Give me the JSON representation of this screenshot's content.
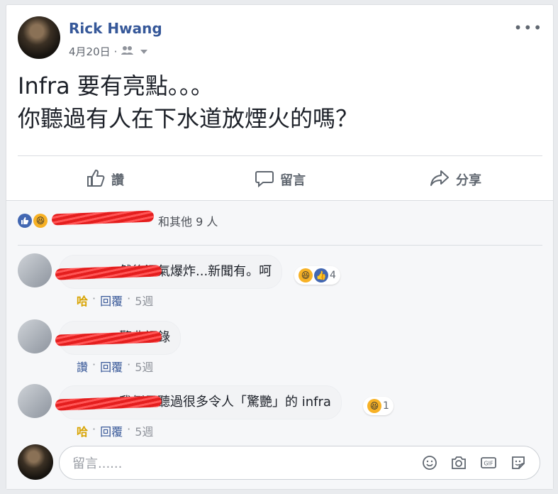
{
  "post": {
    "author": "Rick Hwang",
    "date": "4月20日",
    "more": "•••",
    "lines": [
      "Infra 要有亮點。。。",
      "你聽過有人在下水道放煙火的嗎？"
    ]
  },
  "actions": [
    {
      "label": "讚",
      "icon": "like-icon"
    },
    {
      "label": "留言",
      "icon": "comment-icon"
    },
    {
      "label": "分享",
      "icon": "share-icon"
    }
  ],
  "reactions": {
    "text": "和其他 9 人"
  },
  "comments": [
    {
      "text": "然後沼氣爆炸...新聞有。呵",
      "reaction_count": "4",
      "actions": {
        "first": "哈",
        "reply": "回覆",
        "time": "5週"
      }
    },
    {
      "text": "驚典語錄",
      "reaction_count": "",
      "actions": {
        "first": "讚",
        "reply": "回覆",
        "time": "5週"
      }
    },
    {
      "text": "我倒是聽過很多令人「驚艷」的 infra",
      "reaction_count": "1",
      "actions": {
        "first": "哈",
        "reply": "回覆",
        "time": "5週"
      }
    }
  ],
  "composer": {
    "placeholder": "留言......"
  },
  "colors": {
    "author": "#365899",
    "link": "#385898",
    "haha": "#f7b125",
    "like": "#4267b2"
  }
}
